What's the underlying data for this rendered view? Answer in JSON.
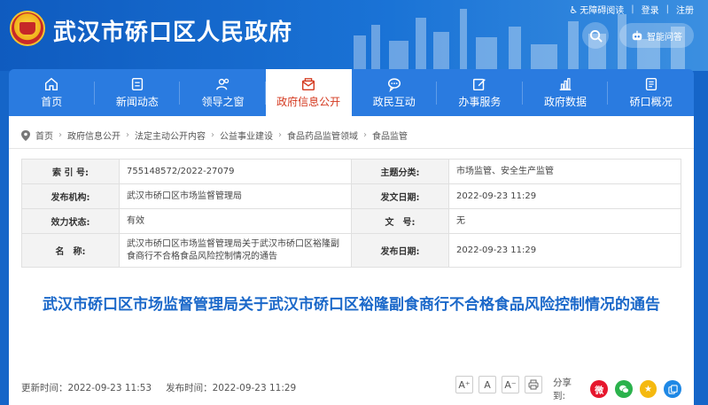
{
  "header": {
    "site_title": "武汉市硚口区人民政府",
    "top_links": {
      "accessibility": "无障碍阅读",
      "login": "登录",
      "register": "注册",
      "separator": "|"
    },
    "qa_label": "智能问答"
  },
  "nav": {
    "items": [
      {
        "label": "首页",
        "icon": "home-icon"
      },
      {
        "label": "新闻动态",
        "icon": "news-icon"
      },
      {
        "label": "领导之窗",
        "icon": "leaders-icon"
      },
      {
        "label": "政府信息公开",
        "icon": "envelope-icon",
        "active": true
      },
      {
        "label": "政民互动",
        "icon": "chat-icon"
      },
      {
        "label": "办事服务",
        "icon": "edit-icon"
      },
      {
        "label": "政府数据",
        "icon": "bar-chart-icon"
      },
      {
        "label": "硚口概况",
        "icon": "document-icon"
      }
    ]
  },
  "breadcrumb": [
    "首页",
    "政府信息公开",
    "法定主动公开内容",
    "公益事业建设",
    "食品药品监管领域",
    "食品监管"
  ],
  "meta": {
    "rows": [
      {
        "l1": "索 引 号:",
        "v1": "755148572/2022-27079",
        "l2": "主题分类:",
        "v2": "市场监管、安全生产监管"
      },
      {
        "l1": "发布机构:",
        "v1": "武汉市硚口区市场监督管理局",
        "l2": "发文日期:",
        "v2": "2022-09-23 11:29"
      },
      {
        "l1": "效力状态:",
        "v1": "有效",
        "l2": "文　号:",
        "v2": "无"
      },
      {
        "l1": "名　称:",
        "v1": "武汉市硚口区市场监督管理局关于武汉市硚口区裕隆副食商行不合格食品风险控制情况的通告",
        "l2": "发布日期:",
        "v2": "2022-09-23 11:29"
      }
    ]
  },
  "doc_title": "武汉市硚口区市场监督管理局关于武汉市硚口区裕隆副食商行不合格食品风险控制情况的通告",
  "footer": {
    "update_time": "更新时间：2022-09-23 11:53",
    "publish_time": "发布时间：2022-09-23 11:29",
    "font_buttons": [
      "A⁺",
      "A",
      "A⁻"
    ],
    "share_label": "分享到:"
  },
  "colors": {
    "primary": "#1565c8",
    "active_nav_text": "#d4391f",
    "title_blue": "#1b68c9"
  }
}
